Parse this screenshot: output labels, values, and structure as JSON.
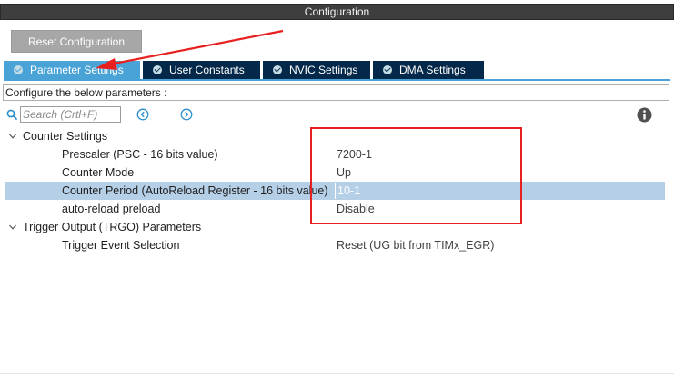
{
  "window": {
    "title": "Configuration"
  },
  "toolbar": {
    "reset_label": "Reset Configuration"
  },
  "tabs": [
    {
      "label": "Parameter Settings",
      "active": true
    },
    {
      "label": "User Constants",
      "active": false
    },
    {
      "label": "NVIC Settings",
      "active": false
    },
    {
      "label": "DMA Settings",
      "active": false
    }
  ],
  "config_hint": "Configure the below parameters :",
  "search": {
    "placeholder": "Search (Crtl+F)"
  },
  "icons": {
    "search": "search-icon",
    "previous": "chevron-left-circle-icon",
    "next": "chevron-right-circle-icon",
    "info": "info-icon"
  },
  "tree": {
    "groups": [
      {
        "label": "Counter Settings",
        "expanded": true,
        "params": [
          {
            "name": "Prescaler (PSC - 16 bits value)",
            "value": "7200-1",
            "selected": false
          },
          {
            "name": "Counter Mode",
            "value": "Up",
            "selected": false
          },
          {
            "name": "Counter Period (AutoReload Register - 16 bits value)",
            "value": "10-1",
            "selected": true
          },
          {
            "name": "auto-reload preload",
            "value": "Disable",
            "selected": false
          }
        ]
      },
      {
        "label": "Trigger Output (TRGO) Parameters",
        "expanded": true,
        "params": [
          {
            "name": "Trigger Event Selection",
            "value": "Reset (UG bit from TIMx_EGR)",
            "selected": false
          }
        ]
      }
    ]
  },
  "colors": {
    "tab_active": "#4aa3d6",
    "tab_inactive": "#032849",
    "title_bar": "#3e3e3e",
    "button": "#a7a7a7",
    "selection": "#b5cfe6",
    "annotation": "#e8201f",
    "accent_icon": "#2a8fd0"
  }
}
